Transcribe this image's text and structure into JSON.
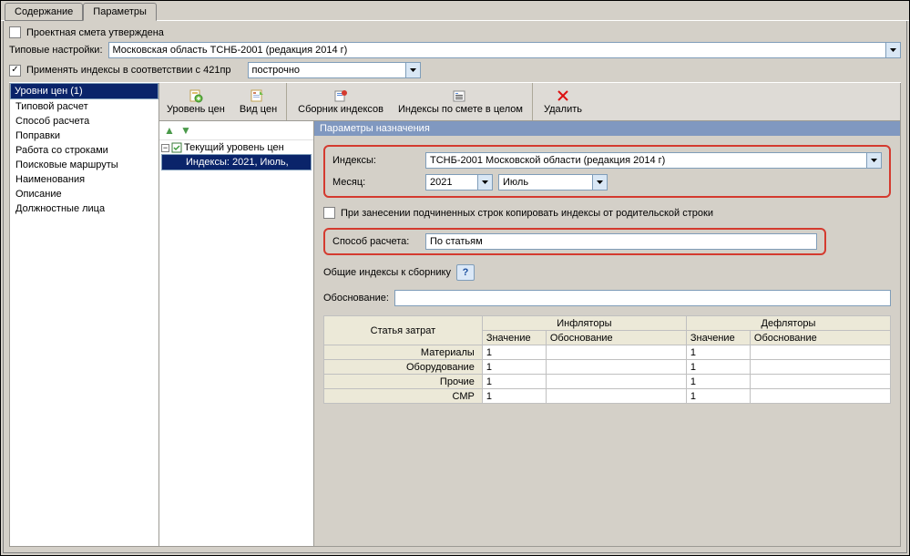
{
  "tabs": {
    "content": "Содержание",
    "params": "Параметры"
  },
  "approved": {
    "label": "Проектная смета утверждена",
    "checked": false
  },
  "typical_settings": {
    "label": "Типовые настройки:",
    "value": "Московская область ТСНБ-2001 (редакция 2014 г)"
  },
  "apply_indices": {
    "label": "Применять индексы в соответствии с 421пр",
    "checked": true,
    "mode": "построчно"
  },
  "sidebar": [
    "Уровни цен (1)",
    "Типовой расчет",
    "Способ расчета",
    "Поправки",
    "Работа со строками",
    "Поисковые маршруты",
    "Наименования",
    "Описание",
    "Должностные лица"
  ],
  "toolbar": {
    "level": "Уровень цен",
    "view": "Вид цен",
    "collection": "Сборник индексов",
    "whole": "Индексы по смете в целом",
    "delete": "Удалить"
  },
  "tree": {
    "root": "Текущий уровень цен",
    "child": "Индексы: 2021, Июль,"
  },
  "params_header": "Параметры назначения",
  "indices": {
    "label": "Индексы:",
    "value": "ТСНБ-2001 Московской области (редакция 2014 г)"
  },
  "month": {
    "label": "Месяц:",
    "year": "2021",
    "month": "Июль"
  },
  "copy_parent": {
    "label": "При занесении подчиненных строк копировать индексы от родительской строки",
    "checked": false
  },
  "calc_method": {
    "label": "Способ расчета:",
    "value": "По статьям"
  },
  "common_indices": {
    "label": "Общие индексы к сборнику"
  },
  "justification": {
    "label": "Обоснование:",
    "value": ""
  },
  "table": {
    "h_item": "Статья затрат",
    "h_infl": "Инфляторы",
    "h_defl": "Дефляторы",
    "h_val": "Значение",
    "h_just": "Обоснование",
    "rows": [
      {
        "name": "Материалы",
        "iv": "1",
        "ij": "",
        "dv": "1",
        "dj": ""
      },
      {
        "name": "Оборудование",
        "iv": "1",
        "ij": "",
        "dv": "1",
        "dj": ""
      },
      {
        "name": "Прочие",
        "iv": "1",
        "ij": "",
        "dv": "1",
        "dj": ""
      },
      {
        "name": "СМР",
        "iv": "1",
        "ij": "",
        "dv": "1",
        "dj": ""
      }
    ]
  }
}
